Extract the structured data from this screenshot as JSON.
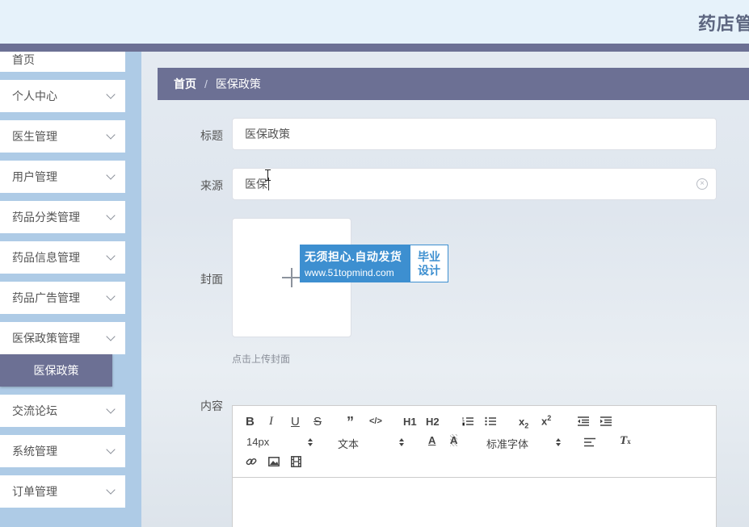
{
  "header": {
    "brand": "药店管"
  },
  "sidebar": {
    "items": [
      {
        "label": "首页",
        "has_chevron": false
      },
      {
        "label": "个人中心"
      },
      {
        "label": "医生管理"
      },
      {
        "label": "用户管理"
      },
      {
        "label": "药品分类管理"
      },
      {
        "label": "药品信息管理"
      },
      {
        "label": "药品广告管理"
      },
      {
        "label": "医保政策管理"
      },
      {
        "label": "交流论坛"
      },
      {
        "label": "系统管理"
      },
      {
        "label": "订单管理"
      }
    ],
    "active_sub": "医保政策"
  },
  "breadcrumb": {
    "home": "首页",
    "separator": "/",
    "current": "医保政策"
  },
  "form": {
    "title_label": "标题",
    "title_value": "医保政策",
    "source_label": "来源",
    "source_value": "医保",
    "cover_label": "封面",
    "cover_tip": "点击上传封面",
    "content_label": "内容"
  },
  "watermark": {
    "line1": "无须担心.自动发货",
    "line2": "www.51topmind.com",
    "side_top": "毕业",
    "side_bottom": "设计"
  },
  "editor": {
    "font_size": "14px",
    "header_picker": "文本",
    "font_picker": "标准字体",
    "h1": "H1",
    "h2": "H2"
  },
  "colors": {
    "accent": "#6c7094",
    "sidebar_bg": "#aecbe6",
    "header_bg": "#e6f2fa",
    "watermark_blue": "#3d8fd0"
  }
}
